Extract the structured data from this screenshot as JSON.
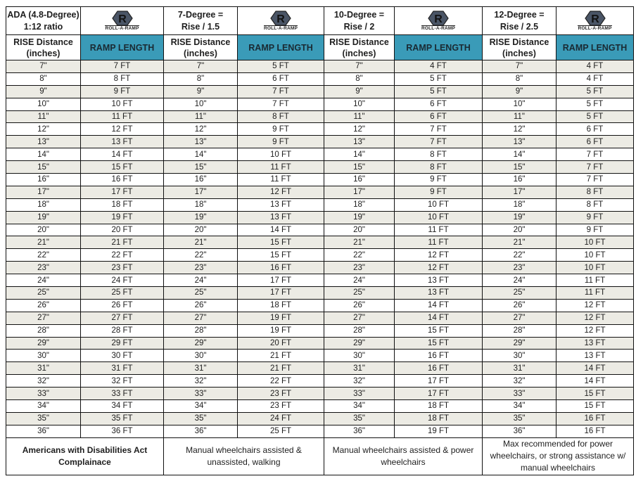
{
  "brand": {
    "name": "ROLL-A-RAMP",
    "logo_icon": "hexagon-r-logo-icon",
    "logo_color": "#4a5566",
    "header_accent": "#3a9bb8",
    "stripe_color": "#ecebe4"
  },
  "groups": [
    {
      "title_line1": "ADA (4.8-Degree)",
      "title_line2": "1:12 ratio",
      "rise_header_line1": "RISE Distance",
      "rise_header_line2": "(inches)",
      "length_header": "RAMP LENGTH",
      "footer": "Americans with Disabilities Act Complainace"
    },
    {
      "title_line1": "7-Degree =",
      "title_line2": "Rise / 1.5",
      "rise_header_line1": "RISE Distance",
      "rise_header_line2": "(inches)",
      "length_header": "RAMP LENGTH",
      "footer": "Manual wheelchairs assisted & unassisted, walking"
    },
    {
      "title_line1": "10-Degree =",
      "title_line2": "Rise / 2",
      "rise_header_line1": "RISE Distance",
      "rise_header_line2": "(inches)",
      "length_header": "RAMP LENGTH",
      "footer": "Manual wheelchairs assisted & power wheelchairs"
    },
    {
      "title_line1": "12-Degree =",
      "title_line2": "Rise / 2.5",
      "rise_header_line1": "RISE Distance",
      "rise_header_line2": "(inches)",
      "length_header": "RAMP LENGTH",
      "footer": "Max recommended for power wheelchairs, or strong assistance w/ manual wheelchairs"
    }
  ],
  "rows": [
    [
      "7\"",
      "7 FT",
      "7\"",
      "5 FT",
      "7\"",
      "4 FT",
      "7\"",
      "4 FT"
    ],
    [
      "8\"",
      "8 FT",
      "8\"",
      "6 FT",
      "8\"",
      "5 FT",
      "8\"",
      "4 FT"
    ],
    [
      "9\"",
      "9 FT",
      "9\"",
      "7 FT",
      "9\"",
      "5 FT",
      "9\"",
      "5 FT"
    ],
    [
      "10\"",
      "10 FT",
      "10\"",
      "7 FT",
      "10\"",
      "6 FT",
      "10\"",
      "5 FT"
    ],
    [
      "11\"",
      "11 FT",
      "11\"",
      "8 FT",
      "11\"",
      "6 FT",
      "11\"",
      "5 FT"
    ],
    [
      "12\"",
      "12 FT",
      "12\"",
      "9 FT",
      "12\"",
      "7 FT",
      "12\"",
      "6 FT"
    ],
    [
      "13\"",
      "13 FT",
      "13\"",
      "9 FT",
      "13\"",
      "7 FT",
      "13\"",
      "6 FT"
    ],
    [
      "14\"",
      "14 FT",
      "14\"",
      "10 FT",
      "14\"",
      "8 FT",
      "14\"",
      "7 FT"
    ],
    [
      "15\"",
      "15 FT",
      "15\"",
      "11 FT",
      "15\"",
      "8 FT",
      "15\"",
      "7 FT"
    ],
    [
      "16\"",
      "16 FT",
      "16\"",
      "11 FT",
      "16\"",
      "9 FT",
      "16\"",
      "7 FT"
    ],
    [
      "17\"",
      "17 FT",
      "17\"",
      "12 FT",
      "17\"",
      "9 FT",
      "17\"",
      "8 FT"
    ],
    [
      "18\"",
      "18 FT",
      "18\"",
      "13 FT",
      "18\"",
      "10 FT",
      "18\"",
      "8 FT"
    ],
    [
      "19\"",
      "19 FT",
      "19\"",
      "13 FT",
      "19\"",
      "10 FT",
      "19\"",
      "9 FT"
    ],
    [
      "20\"",
      "20 FT",
      "20\"",
      "14 FT",
      "20\"",
      "11 FT",
      "20\"",
      "9 FT"
    ],
    [
      "21\"",
      "21 FT",
      "21\"",
      "15 FT",
      "21\"",
      "11 FT",
      "21\"",
      "10 FT"
    ],
    [
      "22\"",
      "22 FT",
      "22\"",
      "15 FT",
      "22\"",
      "12 FT",
      "22\"",
      "10 FT"
    ],
    [
      "23\"",
      "23 FT",
      "23\"",
      "16 FT",
      "23\"",
      "12 FT",
      "23\"",
      "10 FT"
    ],
    [
      "24\"",
      "24 FT",
      "24\"",
      "17 FT",
      "24\"",
      "13 FT",
      "24\"",
      "11 FT"
    ],
    [
      "25\"",
      "25 FT",
      "25\"",
      "17 FT",
      "25\"",
      "13 FT",
      "25\"",
      "11 FT"
    ],
    [
      "26\"",
      "26 FT",
      "26\"",
      "18 FT",
      "26\"",
      "14 FT",
      "26\"",
      "12 FT"
    ],
    [
      "27\"",
      "27 FT",
      "27\"",
      "19 FT",
      "27\"",
      "14 FT",
      "27\"",
      "12 FT"
    ],
    [
      "28\"",
      "28 FT",
      "28\"",
      "19 FT",
      "28\"",
      "15 FT",
      "28\"",
      "12 FT"
    ],
    [
      "29\"",
      "29 FT",
      "29\"",
      "20 FT",
      "29\"",
      "15 FT",
      "29\"",
      "13 FT"
    ],
    [
      "30\"",
      "30 FT",
      "30\"",
      "21 FT",
      "30\"",
      "16 FT",
      "30\"",
      "13 FT"
    ],
    [
      "31\"",
      "31 FT",
      "31\"",
      "21 FT",
      "31\"",
      "16 FT",
      "31\"",
      "14 FT"
    ],
    [
      "32\"",
      "32 FT",
      "32\"",
      "22 FT",
      "32\"",
      "17 FT",
      "32\"",
      "14 FT"
    ],
    [
      "33\"",
      "33 FT",
      "33\"",
      "23 FT",
      "33\"",
      "17 FT",
      "33\"",
      "15 FT"
    ],
    [
      "34\"",
      "34 FT",
      "34\"",
      "23 FT",
      "34\"",
      "18 FT",
      "34\"",
      "15 FT"
    ],
    [
      "35\"",
      "35 FT",
      "35\"",
      "24 FT",
      "35\"",
      "18 FT",
      "35\"",
      "16 FT"
    ],
    [
      "36\"",
      "36 FT",
      "36\"",
      "25 FT",
      "36\"",
      "19 FT",
      "36\"",
      "16 FT"
    ]
  ]
}
